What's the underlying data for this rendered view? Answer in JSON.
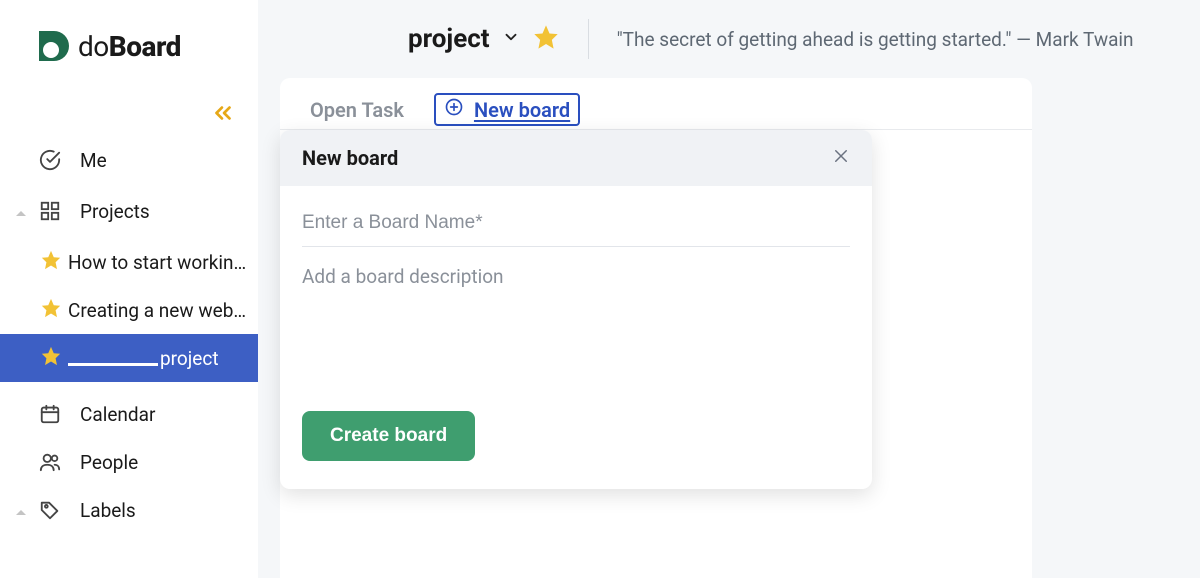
{
  "brand": {
    "part1": "do",
    "part2": "Board"
  },
  "sidebar": {
    "me": "Me",
    "projects": "Projects",
    "calendar": "Calendar",
    "people": "People",
    "labels": "Labels",
    "projectItems": [
      {
        "label": "How to start workin…"
      },
      {
        "label": "Creating a new web…"
      },
      {
        "label": "project"
      }
    ]
  },
  "topbar": {
    "project_name": "project",
    "quote": "\"The secret of getting ahead is getting started.\" — Mark Twain"
  },
  "tabs": {
    "open_task": "Open Task",
    "new_board": "New board"
  },
  "modal": {
    "title": "New board",
    "name_placeholder": "Enter a Board Name*",
    "desc_placeholder": "Add a board description",
    "create_label": "Create board"
  }
}
